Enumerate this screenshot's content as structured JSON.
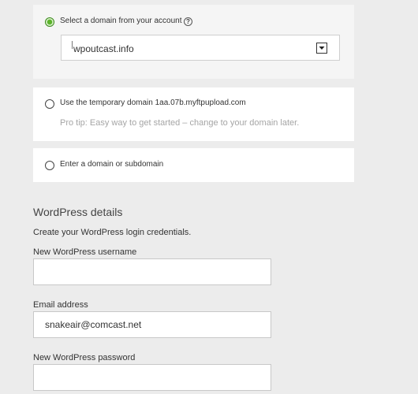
{
  "domain_options": {
    "account": {
      "label": "Select a domain from your account",
      "selected": true,
      "help_icon_glyph": "?",
      "select_value": "wpoutcast.info"
    },
    "temporary": {
      "label": "Use the temporary domain 1aa.07b.myftpupload.com",
      "tip": "Pro tip: Easy way to get started – change to your domain later.",
      "selected": false
    },
    "custom": {
      "label": "Enter a domain or subdomain",
      "selected": false
    }
  },
  "wordpress": {
    "title": "WordPress details",
    "description": "Create your WordPress login credentials.",
    "username": {
      "label": "New WordPress username",
      "value": ""
    },
    "email": {
      "label": "Email address",
      "value": "snakeair@comcast.net"
    },
    "password": {
      "label": "New WordPress password",
      "value": ""
    }
  },
  "colors": {
    "page_bg": "#ececec",
    "panel_bg": "#ffffff",
    "radio_selected": "#5cb32c",
    "tip_text": "#a5a5a5"
  }
}
